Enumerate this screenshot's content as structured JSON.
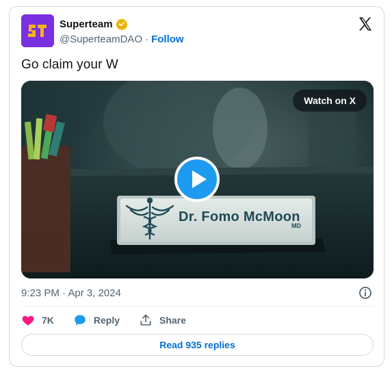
{
  "author": {
    "name": "Superteam",
    "handle": "@SuperteamDAO",
    "separator": "·",
    "follow_label": "Follow",
    "avatar_text": "ST",
    "avatar_color": "#7a2fe0",
    "verified_color": "#e8b400"
  },
  "tweet": {
    "text": "Go claim your W"
  },
  "media": {
    "watch_label": "Watch on X",
    "nameplate_name": "Dr. Fomo McMoon",
    "nameplate_suffix": "MD",
    "play_button_color": "#1d9bf0"
  },
  "meta": {
    "timestamp": "9:23 PM · Apr 3, 2024"
  },
  "actions": {
    "like_count": "7K",
    "reply_label": "Reply",
    "share_label": "Share",
    "like_color": "#f91880",
    "reply_color": "#1d9bf0"
  },
  "footer": {
    "read_replies_label": "Read 935 replies"
  },
  "icons": [
    "verified-badge-icon",
    "x-logo-icon",
    "play-icon",
    "info-icon",
    "heart-icon",
    "reply-bubble-icon",
    "share-icon"
  ]
}
